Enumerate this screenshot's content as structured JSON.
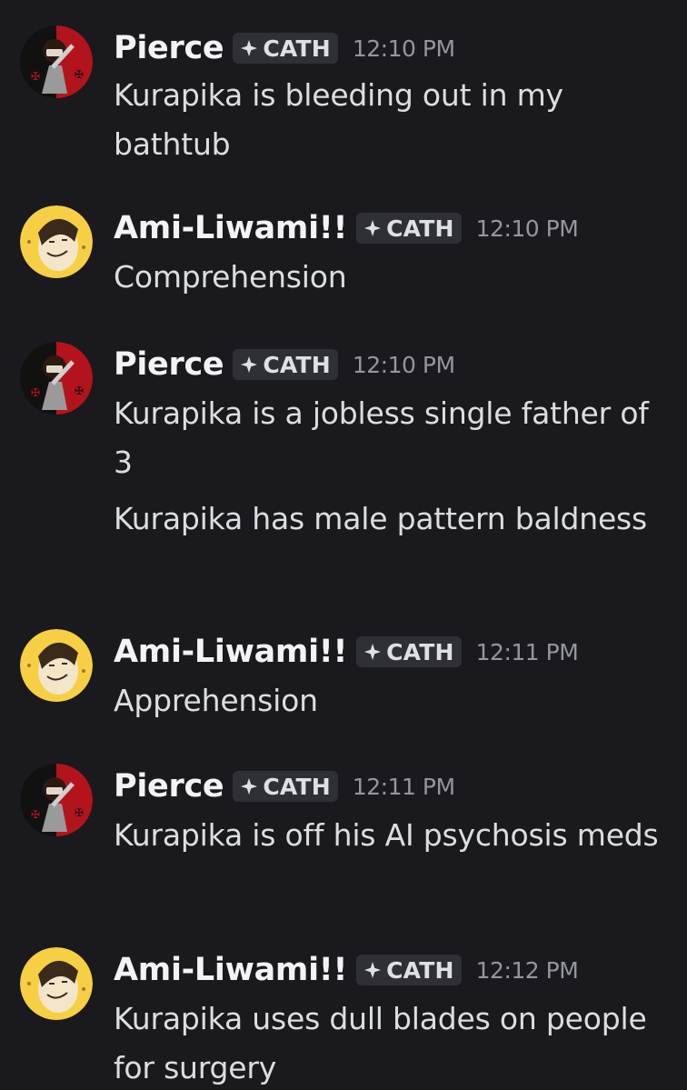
{
  "messages": [
    {
      "author": "Pierce",
      "tag": "CATH",
      "time": "12:10 PM",
      "avatar": "pierce-avatar",
      "lines": [
        "Kurapika is bleeding out in my bathtub"
      ]
    },
    {
      "author": "Ami-Liwami!!",
      "tag": "CATH",
      "time": "12:10 PM",
      "avatar": "ami-avatar",
      "lines": [
        "Comprehension"
      ]
    },
    {
      "author": "Pierce",
      "tag": "CATH",
      "time": "12:10 PM",
      "avatar": "pierce-avatar",
      "lines": [
        "Kurapika is a jobless single father of 3",
        "Kurapika has male pattern baldness"
      ]
    },
    {
      "author": "Ami-Liwami!!",
      "tag": "CATH",
      "time": "12:11 PM",
      "avatar": "ami-avatar",
      "lines": [
        "Apprehension"
      ]
    },
    {
      "author": "Pierce",
      "tag": "CATH",
      "time": "12:11 PM",
      "avatar": "pierce-avatar",
      "lines": [
        "Kurapika is off his AI psychosis meds"
      ]
    },
    {
      "author": "Ami-Liwami!!",
      "tag": "CATH",
      "time": "12:12 PM",
      "avatar": "ami-avatar",
      "lines": [
        "Kurapika uses dull blades on people for surgery"
      ]
    }
  ],
  "colors": {
    "background": "#1a1a1e",
    "username": "#f2f3f5",
    "message_text": "#dbdee1",
    "timestamp": "#94969f",
    "tag_background": "#2f3036",
    "pierce_avatar_red": "#b3141c",
    "ami_avatar_yellow": "#f6cf45"
  }
}
